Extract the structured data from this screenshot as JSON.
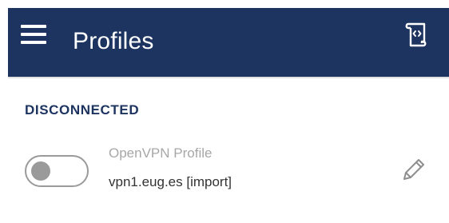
{
  "appbar": {
    "title": "Profiles",
    "menu_icon": "hamburger-menu-icon",
    "import_icon": "import-profile-icon",
    "background_color": "#1d3461"
  },
  "sections": [
    {
      "header": "DISCONNECTED",
      "profiles": [
        {
          "type": "OpenVPN Profile",
          "name": "vpn1.eug.es [import]",
          "connected": false,
          "edit_icon": "pencil-icon"
        }
      ]
    }
  ]
}
